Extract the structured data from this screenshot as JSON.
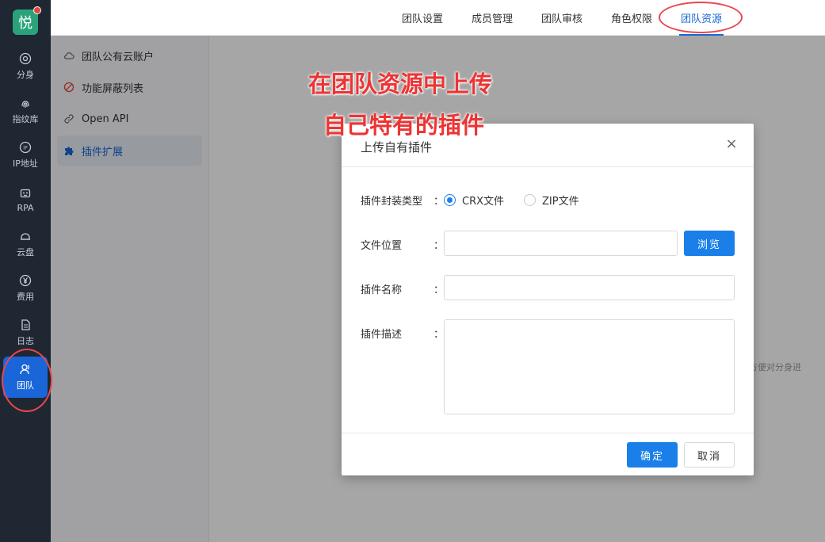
{
  "app": {
    "logo_char": "悦"
  },
  "sidebar": {
    "items": [
      {
        "label": "分身",
        "icon": "chrome-icon"
      },
      {
        "label": "指纹库",
        "icon": "fingerprint-icon"
      },
      {
        "label": "IP地址",
        "icon": "ip-icon"
      },
      {
        "label": "RPA",
        "icon": "robot-icon"
      },
      {
        "label": "云盘",
        "icon": "cloud-drive-icon"
      },
      {
        "label": "费用",
        "icon": "yen-icon"
      },
      {
        "label": "日志",
        "icon": "document-icon"
      },
      {
        "label": "团队",
        "icon": "team-icon",
        "active": true
      }
    ]
  },
  "tabs": [
    {
      "label": "团队设置"
    },
    {
      "label": "成员管理"
    },
    {
      "label": "团队审核"
    },
    {
      "label": "角色权限"
    },
    {
      "label": "团队资源",
      "active": true
    }
  ],
  "submenu": {
    "items": [
      {
        "label": "团队公有云账户",
        "icon": "cloud-icon"
      },
      {
        "label": "功能屏蔽列表",
        "icon": "block-icon"
      },
      {
        "label": "Open API",
        "icon": "link-icon"
      },
      {
        "label": "插件扩展",
        "icon": "puzzle-icon",
        "active": true
      }
    ]
  },
  "background": {
    "partial_text": "方便对分身进"
  },
  "modal": {
    "title": "上传自有插件",
    "close_label": "×",
    "form": {
      "package_type": {
        "label": "插件封装类型",
        "options": [
          {
            "label": "CRX文件",
            "checked": true
          },
          {
            "label": "ZIP文件",
            "checked": false
          }
        ]
      },
      "file_location": {
        "label": "文件位置",
        "value": "",
        "browse_label": "浏览"
      },
      "plugin_name": {
        "label": "插件名称",
        "value": ""
      },
      "plugin_desc": {
        "label": "插件描述",
        "value": ""
      }
    },
    "colon": "：",
    "ok_label": "确定",
    "cancel_label": "取消"
  },
  "annotation": {
    "line1": "在团队资源中上传",
    "line2": "自己特有的插件",
    "color": "#ee3333"
  },
  "colors": {
    "sidebar_bg": "#1f2733",
    "accent": "#1a66d8",
    "primary_button": "#1a7fe8"
  }
}
